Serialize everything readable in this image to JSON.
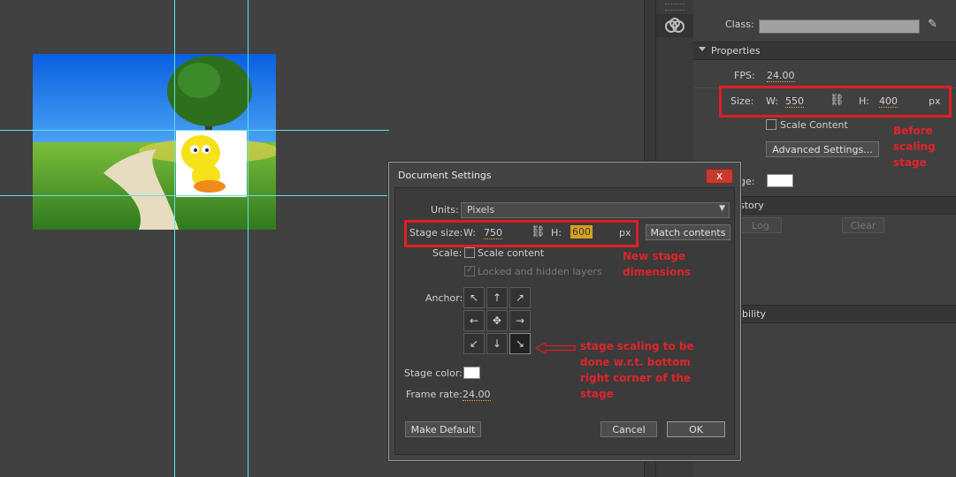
{
  "class_field": {
    "label": "Class:",
    "value": ""
  },
  "properties": {
    "header": "Properties",
    "fps_label": "FPS:",
    "fps_value": "24.00",
    "size_label": "Size:",
    "w_label": "W:",
    "w_value": "550",
    "h_label": "H:",
    "h_value": "400",
    "unit": "px",
    "scale_content": "Scale Content",
    "advanced_settings": "Advanced Settings...",
    "stage_label_partial": "ge:",
    "stage_color": "#ffffff"
  },
  "history": {
    "header": "story",
    "log_button": "Log",
    "clear_button": "Clear"
  },
  "accessibility": {
    "header": "ibility"
  },
  "annotations": {
    "before": "Before scaling stage",
    "new_dims": "New stage dimensions",
    "anchor_note": "stage scaling to be done w.r.t. bottom right corner of the stage"
  },
  "dialog": {
    "title": "Document Settings",
    "close": "x",
    "units_label": "Units:",
    "units_value": "Pixels",
    "stage_size_label": "Stage size:",
    "w_label": "W:",
    "w_value": "750",
    "h_label": "H:",
    "h_value": "600",
    "px": "px",
    "match_contents": "Match contents",
    "scale_label": "Scale:",
    "scale_content": "Scale content",
    "locked_hidden": "Locked and hidden layers",
    "anchor_label": "Anchor:",
    "anchor_glyphs": [
      "↖",
      "↑",
      "↗",
      "←",
      "✥",
      "→",
      "↙",
      "↓",
      "↘"
    ],
    "stage_color_label": "Stage color:",
    "stage_color": "#ffffff",
    "frame_rate_label": "Frame rate:",
    "frame_rate_value": "24.00",
    "make_default": "Make Default",
    "cancel": "Cancel",
    "ok": "OK"
  }
}
